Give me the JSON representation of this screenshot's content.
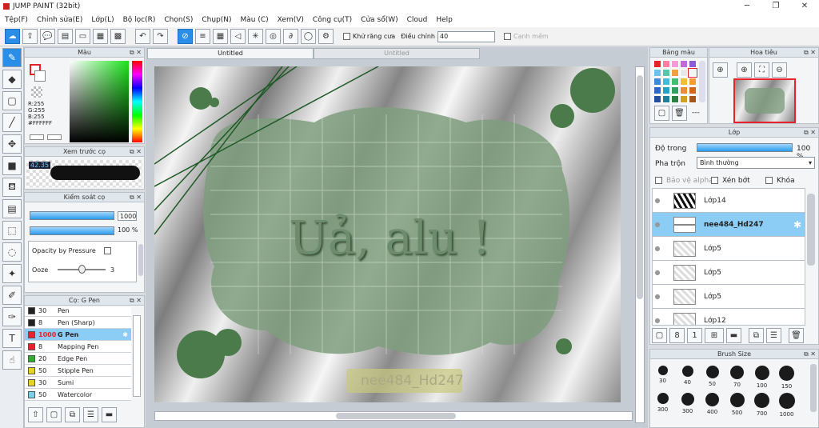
{
  "app": {
    "title": "JUMP PAINT (32bit)",
    "minimize": "─",
    "maximize": "❐",
    "close": "✕"
  },
  "menu": [
    "Tệp(F)",
    "Chỉnh sửa(E)",
    "Lớp(L)",
    "Bộ lọc(R)",
    "Chọn(S)",
    "Chụp(N)",
    "Màu (C)",
    "Xem(V)",
    "Công cụ(T)",
    "Cửa sổ(W)",
    "Cloud",
    "Help"
  ],
  "toolbar": {
    "antialias_label": "Khử răng cưa",
    "adjust_label": "Điều chỉnh",
    "adjust_value": "40",
    "edge_label": "Cạnh mềm"
  },
  "color_panel": {
    "title": "Màu",
    "r": "R:255",
    "g": "G:255",
    "b": "B:255",
    "hex": "#FFFFFF"
  },
  "brush_preview": {
    "title": "Xem trước cọ",
    "size": "42.35"
  },
  "brush_control": {
    "title": "Kiểm soát cọ",
    "size": "1000",
    "opacity": "100 %",
    "pressure_label": "Opacity by Pressure",
    "ooze_label": "Ooze",
    "ooze_value": "3"
  },
  "brush_list": {
    "title": "Cọ: G Pen",
    "items": [
      {
        "size": "30",
        "name": "Pen",
        "color": "#222222"
      },
      {
        "size": "8",
        "name": "Pen (Sharp)",
        "color": "#222222"
      },
      {
        "size": "1000",
        "name": "G Pen",
        "color": "#e8222a"
      },
      {
        "size": "8",
        "name": "Mapping Pen",
        "color": "#e8222a"
      },
      {
        "size": "20",
        "name": "Edge Pen",
        "color": "#2fae2f"
      },
      {
        "size": "50",
        "name": "Stipple Pen",
        "color": "#e6d22a"
      },
      {
        "size": "30",
        "name": "Sumi",
        "color": "#e6d22a"
      },
      {
        "size": "50",
        "name": "Watercolor",
        "color": "#7ecfe8"
      }
    ]
  },
  "canvas": {
    "tabs": [
      "Untitled",
      "Untitled"
    ],
    "title_text": "Uả, alu !",
    "watermark": "nee484_Hd247"
  },
  "palette": {
    "title": "Bảng màu",
    "more": "---"
  },
  "navigator": {
    "title": "Hoa tiêu"
  },
  "layers": {
    "title": "Lớp",
    "opacity_label": "Độ trong",
    "opacity_value": "100 %",
    "blend_label": "Pha trộn",
    "blend_value": "Bình thường",
    "protect_alpha": "Bảo vệ alpha",
    "clip_label": "Xén bớt",
    "lock_label": "Khóa",
    "items": [
      {
        "name": "Lớp14"
      },
      {
        "name": "nee484_Hd247"
      },
      {
        "name": "Lớp5"
      },
      {
        "name": "Lớp5"
      },
      {
        "name": "Lớp5"
      },
      {
        "name": "Lớp12"
      }
    ]
  },
  "brush_size": {
    "title": "Brush Size",
    "values": [
      "30",
      "40",
      "50",
      "70",
      "100",
      "150",
      "300",
      "300",
      "400",
      "500",
      "700",
      "1000"
    ]
  },
  "colors": {
    "accent": "#2a8de8",
    "selected": "#8ccdf6",
    "tab_red": "#e8222a"
  }
}
